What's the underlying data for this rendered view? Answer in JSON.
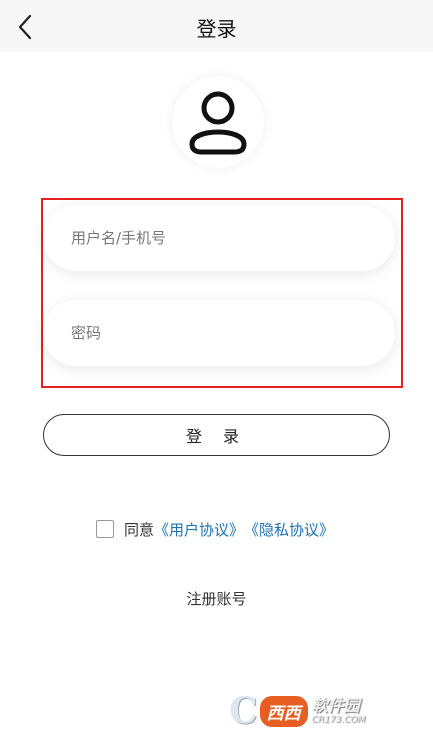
{
  "header": {
    "title": "登录",
    "back_icon": "chevron-left-icon"
  },
  "avatar": {
    "icon": "user-icon"
  },
  "form": {
    "username": {
      "placeholder": "用户名/手机号",
      "value": ""
    },
    "password": {
      "placeholder": "密码",
      "value": ""
    },
    "highlight_color": "#e52222"
  },
  "login_button": {
    "label": "登 录"
  },
  "agreement": {
    "checked": false,
    "prefix": "同意",
    "user_agreement": "《用户协议》",
    "privacy_policy": "《隐私协议》",
    "link_color": "#1a73b8"
  },
  "register_link": {
    "label": "注册账号"
  },
  "watermark": {
    "letter": "C",
    "badge": "西西",
    "name": "软件园",
    "url": "CR173.COM"
  }
}
